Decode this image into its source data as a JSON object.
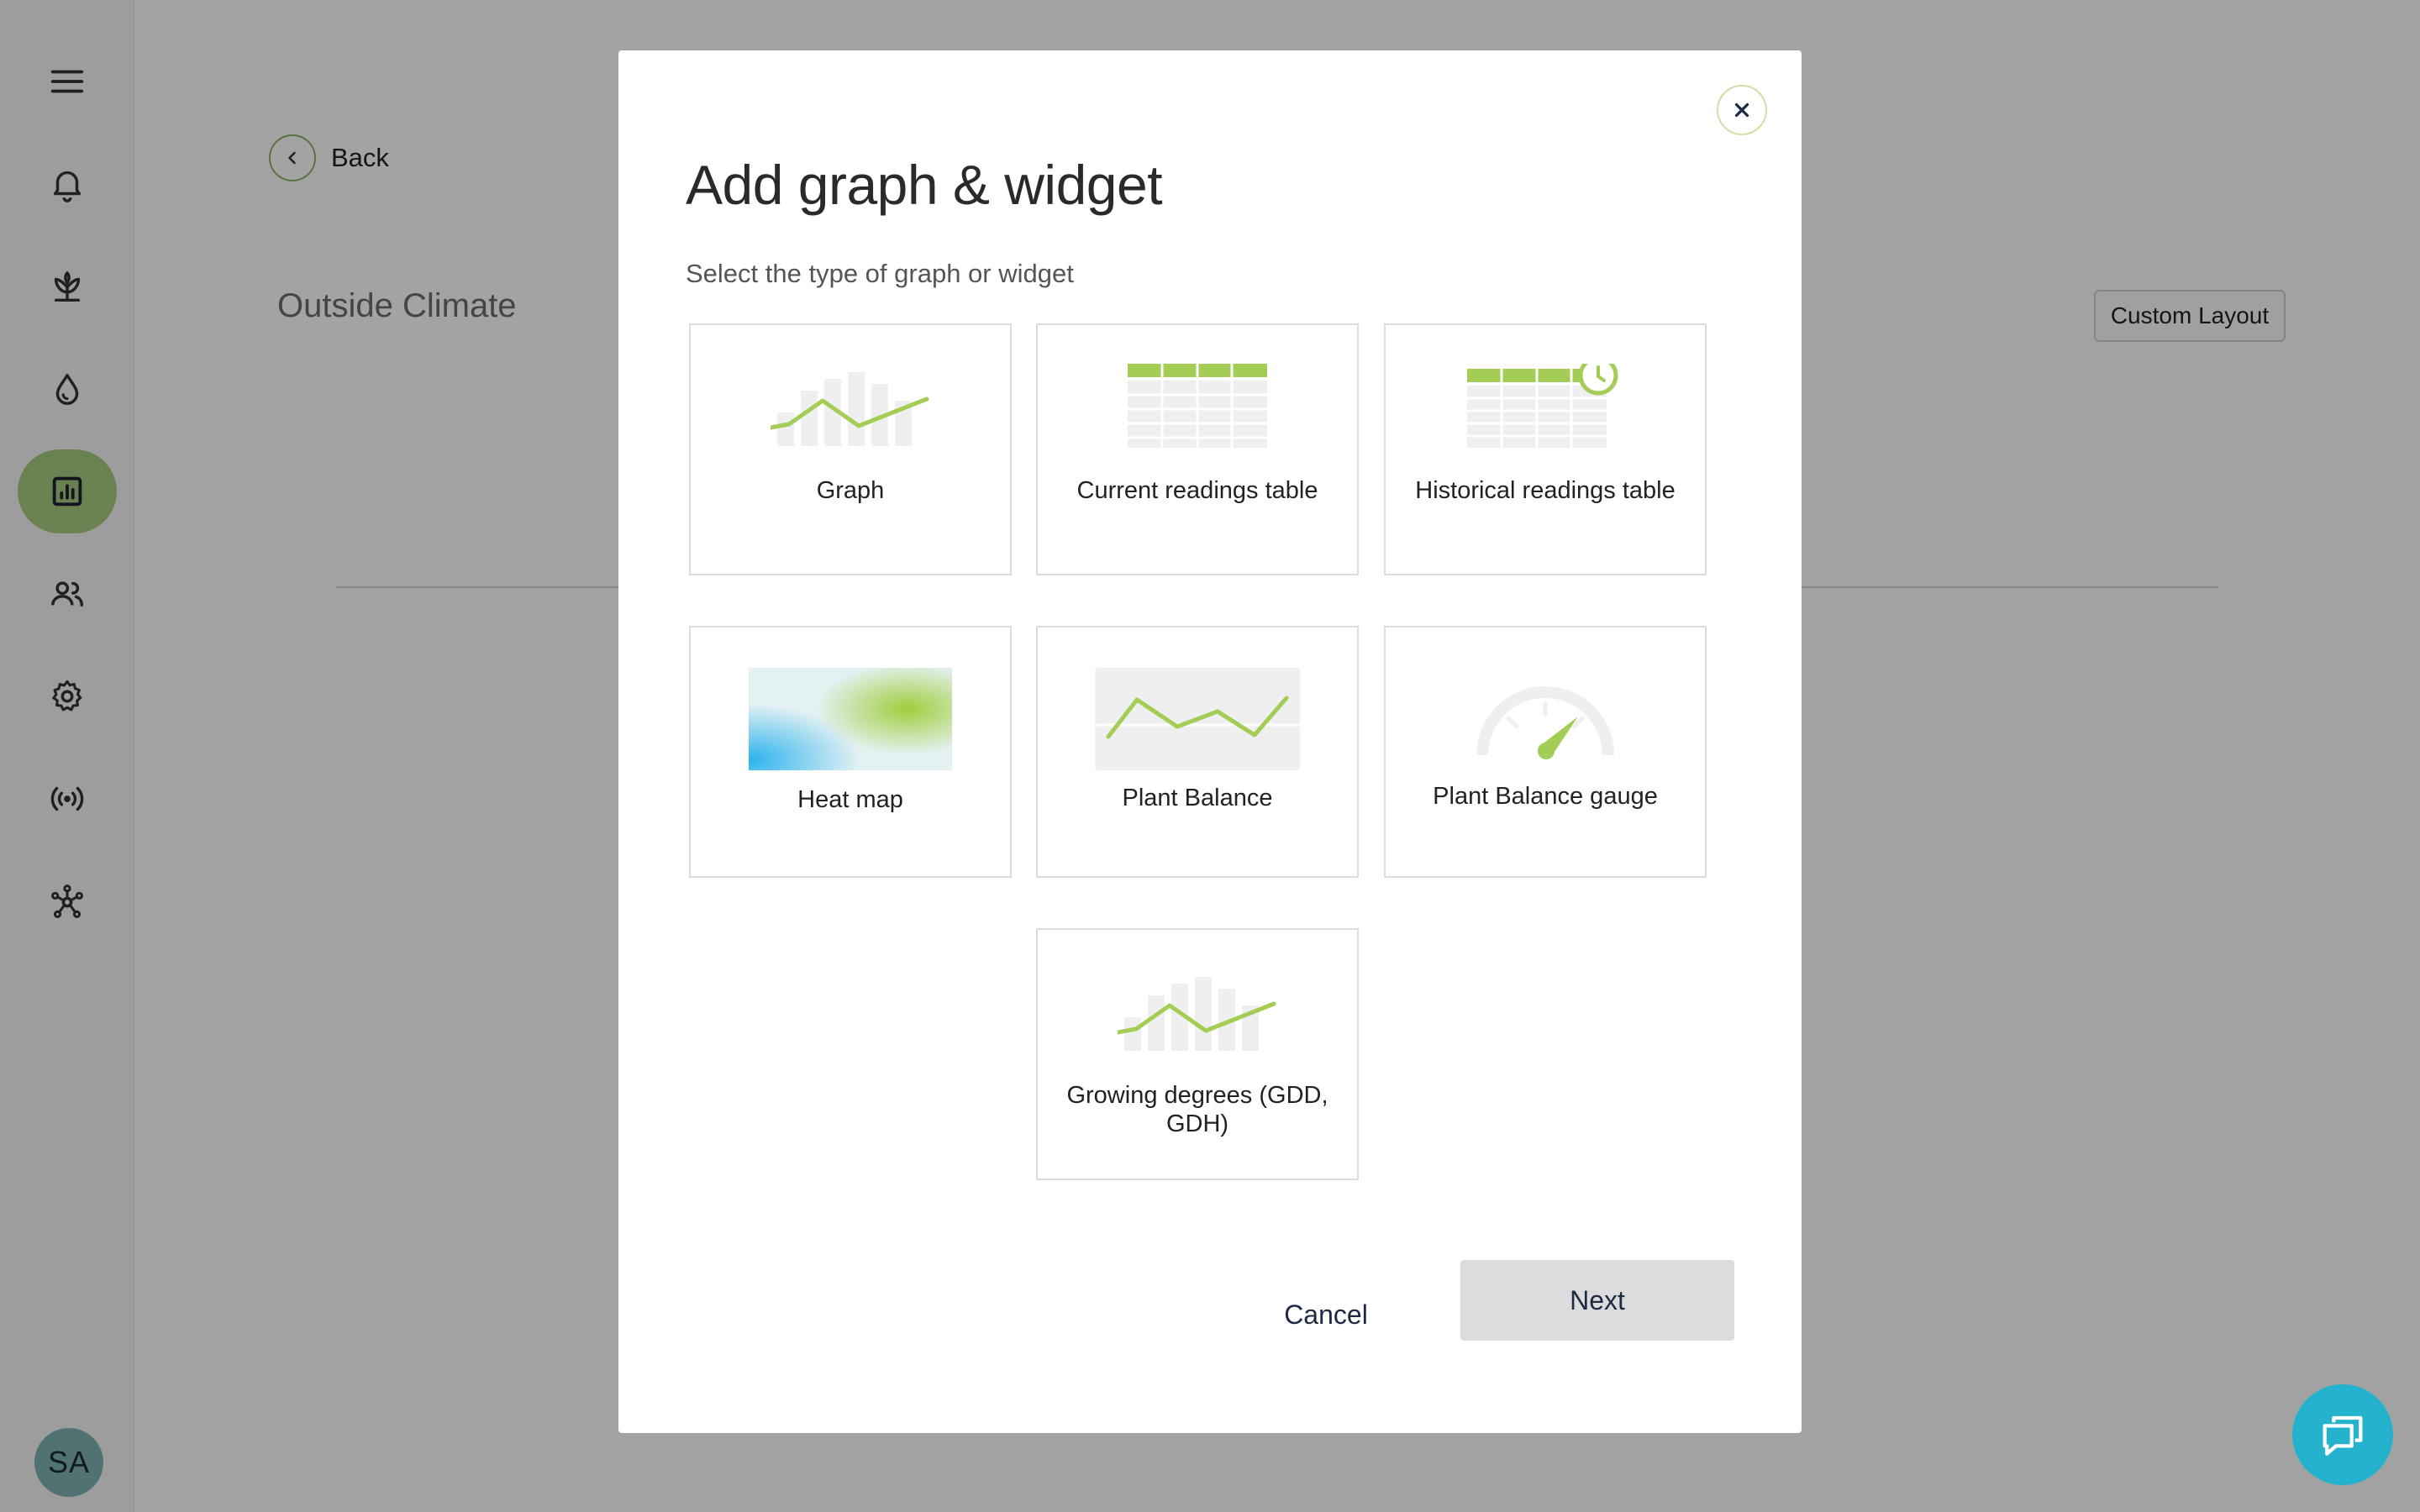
{
  "sidebar": {
    "items": [
      {
        "name": "menu-icon"
      },
      {
        "name": "bell-icon"
      },
      {
        "name": "plant-icon"
      },
      {
        "name": "water-drop-icon"
      },
      {
        "name": "chart-icon",
        "active": true
      },
      {
        "name": "users-icon"
      },
      {
        "name": "gear-icon"
      },
      {
        "name": "broadcast-icon"
      },
      {
        "name": "network-icon"
      }
    ],
    "avatar_initials": "SA"
  },
  "page": {
    "back_label": "Back",
    "title": "Outside Climate",
    "custom_layout_label": "Custom Layout"
  },
  "modal": {
    "title": "Add graph & widget",
    "subtitle": "Select the type of graph or widget",
    "options": [
      {
        "label": "Graph",
        "icon": "bar-line-chart-icon"
      },
      {
        "label": "Current readings table",
        "icon": "table-icon"
      },
      {
        "label": "Historical readings table",
        "icon": "table-clock-icon"
      },
      {
        "label": "Heat map",
        "icon": "heat-map-icon"
      },
      {
        "label": "Plant Balance",
        "icon": "line-chart-icon"
      },
      {
        "label": "Plant Balance gauge",
        "icon": "gauge-icon"
      },
      {
        "label": "Growing degrees (GDD, GDH)",
        "icon": "bar-line-chart-icon"
      }
    ],
    "cancel_label": "Cancel",
    "next_label": "Next"
  },
  "colors": {
    "accent_green": "#a6ca80",
    "icon_green": "#a3cd55",
    "chat_blue": "#25b2cc",
    "overlay": "rgba(0,0,0,0.36)"
  }
}
